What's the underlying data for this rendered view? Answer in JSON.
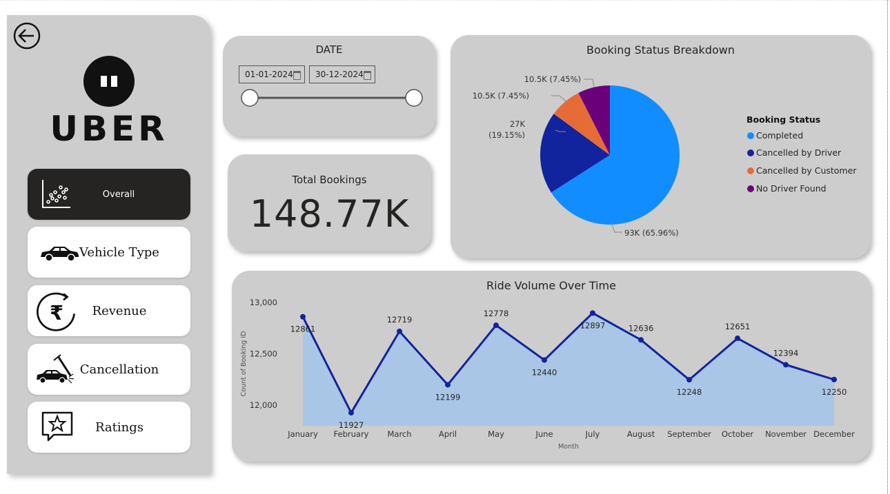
{
  "sidebar": {
    "logo_text": "UBER",
    "items": [
      {
        "label": "Overall",
        "icon": "scatter-chart-icon",
        "active": true
      },
      {
        "label": "Vehicle Type",
        "icon": "car-icon"
      },
      {
        "label": "Revenue",
        "icon": "rupee-icon"
      },
      {
        "label": "Cancellation",
        "icon": "car-crash-icon"
      },
      {
        "label": "Ratings",
        "icon": "star-review-icon"
      }
    ]
  },
  "date_filter": {
    "title": "DATE",
    "start": "01-01-2024",
    "end": "30-12-2024"
  },
  "kpi": {
    "label": "Total Bookings",
    "value": "148.77K"
  },
  "colors": {
    "completed": "#118dff",
    "cancelled_driver": "#12239e",
    "cancelled_customer": "#e66c37",
    "no_driver": "#6b007b",
    "line": "#12239e",
    "area": "#a9c6e6",
    "card_bg": "#cdcdcd"
  },
  "charts": {
    "pie_title": "Booking Status Breakdown",
    "line_title": "Ride Volume Over Time"
  },
  "chart_data": [
    {
      "type": "pie",
      "title": "Booking Status Breakdown",
      "legend_title": "Booking Status",
      "legend_position": "right",
      "slices": [
        {
          "name": "Completed",
          "value": 93000,
          "label": "93K (65.96%)",
          "percent": 65.96
        },
        {
          "name": "Cancelled by Driver",
          "value": 27000,
          "label": "27K (19.15%)",
          "percent": 19.15
        },
        {
          "name": "Cancelled by Customer",
          "value": 10500,
          "label": "10.5K (7.45%)",
          "percent": 7.45
        },
        {
          "name": "No Driver Found",
          "value": 10500,
          "label": "10.5K (7.45%)",
          "percent": 7.45
        }
      ]
    },
    {
      "type": "area",
      "title": "Ride Volume Over Time",
      "xlabel": "Month",
      "ylabel": "Count of Booking ID",
      "categories": [
        "January",
        "February",
        "March",
        "April",
        "May",
        "June",
        "July",
        "August",
        "September",
        "October",
        "November",
        "December"
      ],
      "values": [
        12861,
        11927,
        12719,
        12199,
        12778,
        12440,
        12897,
        12636,
        12248,
        12651,
        12394,
        12250
      ],
      "yticks": [
        "12,000",
        "12,500",
        "13,000"
      ],
      "ytick_values": [
        12000,
        12500,
        13000
      ],
      "ylim": [
        11800,
        13000
      ],
      "grid": false
    }
  ]
}
